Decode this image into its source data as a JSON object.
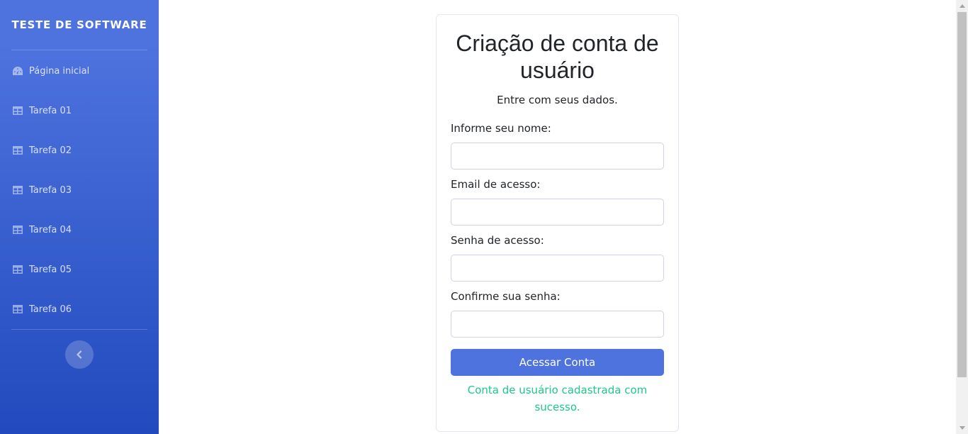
{
  "sidebar": {
    "brand": "TESTE DE SOFTWARE",
    "home": {
      "label": "Página inicial",
      "icon": "dashboard-icon"
    },
    "items": [
      {
        "label": "Tarefa 01",
        "icon": "table-icon"
      },
      {
        "label": "Tarefa 02",
        "icon": "table-icon"
      },
      {
        "label": "Tarefa 03",
        "icon": "table-icon"
      },
      {
        "label": "Tarefa 04",
        "icon": "table-icon"
      },
      {
        "label": "Tarefa 05",
        "icon": "table-icon"
      },
      {
        "label": "Tarefa 06",
        "icon": "table-icon"
      }
    ],
    "toggle_icon": "chevron-left-icon"
  },
  "form": {
    "title": "Criação de conta de usuário",
    "subtitle": "Entre com seus dados.",
    "name_label": "Informe seu nome:",
    "name_value": "",
    "email_label": "Email de acesso:",
    "email_value": "",
    "password_label": "Senha de acesso:",
    "password_value": "",
    "confirm_label": "Confirme sua senha:",
    "confirm_value": "",
    "submit_label": "Acessar Conta",
    "success_message": "Conta de usuário cadastrada com sucesso."
  },
  "colors": {
    "primary": "#4e73df",
    "sidebar_bottom": "#224abe",
    "success": "#1cc88a"
  }
}
